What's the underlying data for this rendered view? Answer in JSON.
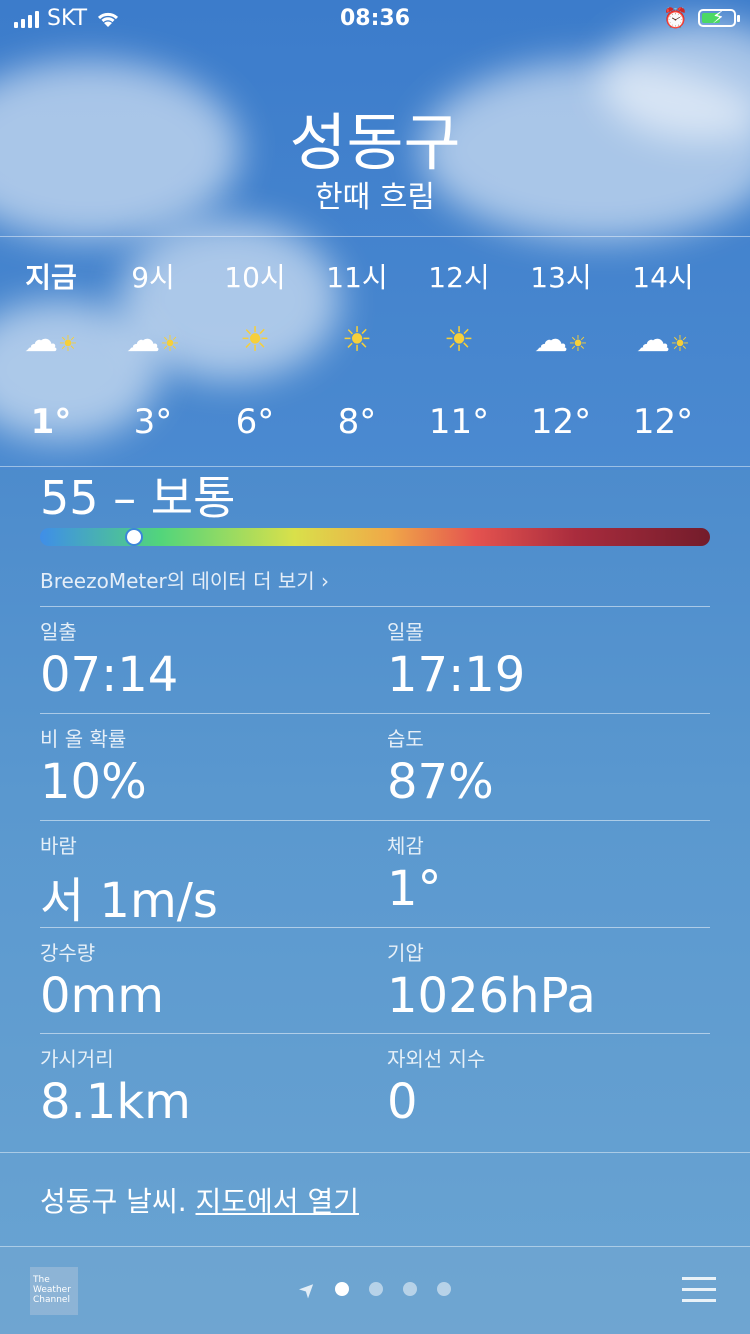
{
  "status_bar": {
    "carrier": "SKT",
    "time": "08:36"
  },
  "location": {
    "city": "성동구",
    "condition": "한때 흐림"
  },
  "hourly": [
    {
      "label": "지금",
      "icon": "partly-cloudy-icon",
      "temp": "1°"
    },
    {
      "label": "9시",
      "icon": "partly-cloudy-icon",
      "temp": "3°"
    },
    {
      "label": "10시",
      "icon": "sun-icon",
      "temp": "6°"
    },
    {
      "label": "11시",
      "icon": "sun-icon",
      "temp": "8°"
    },
    {
      "label": "12시",
      "icon": "sun-icon",
      "temp": "11°"
    },
    {
      "label": "13시",
      "icon": "partly-cloudy-icon",
      "temp": "12°"
    },
    {
      "label": "14시",
      "icon": "partly-cloudy-icon",
      "temp": "12°"
    }
  ],
  "air_quality": {
    "headline": "55 – 보통",
    "level_fraction": 0.14,
    "source_link": "BreezoMeter의 데이터 더 보기 ›"
  },
  "details": [
    {
      "left_label": "일출",
      "left_value": "07:14",
      "right_label": "일몰",
      "right_value": "17:19"
    },
    {
      "left_label": "비 올 확률",
      "left_value": "10%",
      "right_label": "습도",
      "right_value": "87%"
    },
    {
      "left_label": "바람",
      "left_value": "서 1m/s",
      "right_label": "체감",
      "right_value": "1°"
    },
    {
      "left_label": "강수량",
      "left_value": "0mm",
      "right_label": "기압",
      "right_value": "1026hPa"
    },
    {
      "left_label": "가시거리",
      "left_value": "8.1km",
      "right_label": "자외선 지수",
      "right_value": "0"
    }
  ],
  "footer": {
    "prefix": "성동구 날씨.",
    "link": "지도에서 열기"
  },
  "bottom_bar": {
    "logo_text": "The Weather Channel",
    "page_count": 4,
    "active_page": 0
  },
  "colors": {
    "sun": "#f6cf3a",
    "sky": "#4a89cc"
  }
}
